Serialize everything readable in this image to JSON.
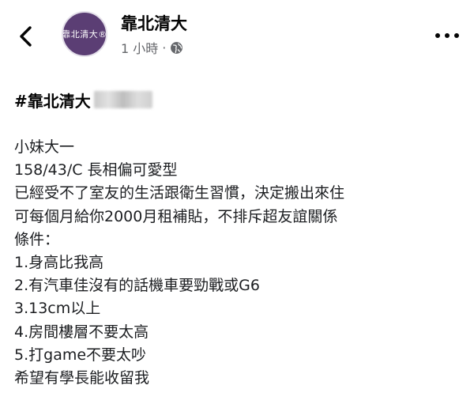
{
  "header": {
    "page_name": "靠北清大",
    "avatar_text": "靠北清大®",
    "timestamp": "1 小時",
    "separator": "·",
    "icons": {
      "back": "chevron-left-icon",
      "audience": "globe-icon",
      "more": "more-horizontal-icon"
    }
  },
  "post": {
    "hashtag": "#靠北清大",
    "lines": [
      "小妹大一",
      "158/43/C 長相偏可愛型",
      "已經受不了室友的生活跟衛生習慣，決定搬出來住",
      "可每個月給你2000月租補貼，不排斥超友誼關係",
      "條件：",
      "1.身高比我高",
      "2.有汽車佳沒有的話機車要勁戰或G6",
      "3.13cm以上",
      "4.房間樓層不要太高",
      "5.打game不要太吵",
      "希望有學長能收留我"
    ]
  },
  "colors": {
    "avatar_bg": "#5b3e74",
    "meta_text": "#65676b",
    "body_text": "#1c1e21"
  }
}
